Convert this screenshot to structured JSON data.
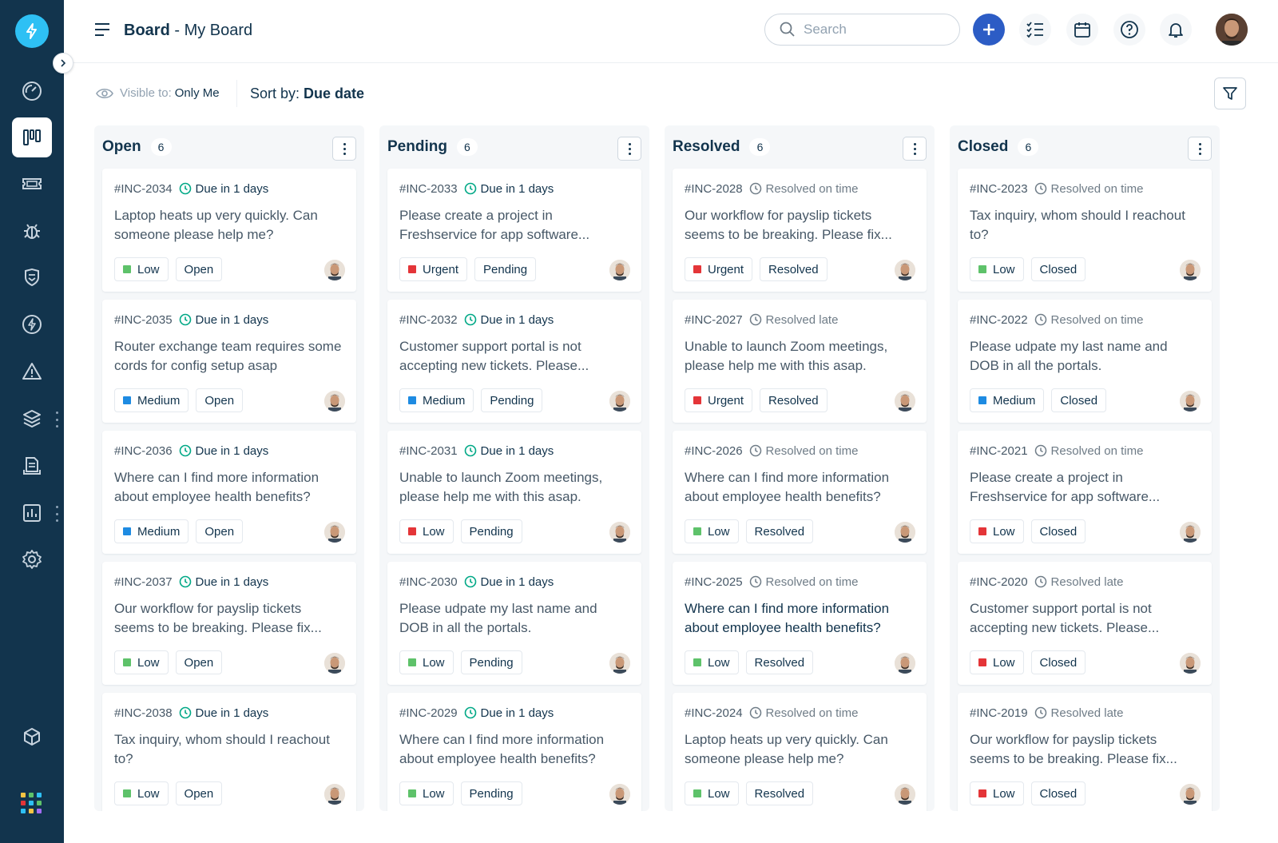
{
  "app": {
    "title_bold": "Board",
    "title_separator": "-",
    "title_name": "My Board"
  },
  "colors": {
    "sidebar": "#12344d",
    "accent": "#2c5cc5",
    "logo": "#2ec0f4",
    "priority_low_green": "#5ec26a",
    "priority_medium": "#1e8be2",
    "priority_urgent": "#e43538",
    "due_green": "#00a886"
  },
  "sidebar": {
    "items": [
      {
        "icon": "dashboard-icon"
      },
      {
        "icon": "board-icon",
        "active": true
      },
      {
        "icon": "ticket-icon"
      },
      {
        "icon": "bug-icon"
      },
      {
        "icon": "shield-icon"
      },
      {
        "icon": "lightning-icon"
      },
      {
        "icon": "alert-icon"
      },
      {
        "icon": "layers-icon"
      },
      {
        "icon": "document-icon"
      },
      {
        "icon": "reports-icon"
      },
      {
        "icon": "gear-icon"
      },
      {
        "icon": "cube-icon"
      },
      {
        "icon": "apps-grid-icon"
      }
    ]
  },
  "header": {
    "search_placeholder": "Search",
    "buttons": [
      "add-icon",
      "checklist-icon",
      "calendar-icon",
      "help-icon",
      "bell-icon"
    ]
  },
  "toolbar": {
    "visible_label": "Visible to:",
    "visible_value": "Only Me",
    "sort_label": "Sort by:",
    "sort_value": "Due date"
  },
  "columns": [
    {
      "title": "Open",
      "count": "6",
      "cards": [
        {
          "id": "#INC-2034",
          "due": "Due in 1 days",
          "due_kind": "green",
          "subject": "Laptop heats up very quickly. Can someone please help me?",
          "priority": "Low",
          "priority_color": "#5ec26a",
          "status": "Open"
        },
        {
          "id": "#INC-2035",
          "due": "Due in 1 days",
          "due_kind": "green",
          "subject": "Router exchange team requires some cords for config setup asap",
          "priority": "Medium",
          "priority_color": "#1e8be2",
          "status": "Open"
        },
        {
          "id": "#INC-2036",
          "due": "Due in 1 days",
          "due_kind": "green",
          "subject": "Where can I find more information about employee health benefits?",
          "priority": "Medium",
          "priority_color": "#1e8be2",
          "status": "Open"
        },
        {
          "id": "#INC-2037",
          "due": "Due in 1 days",
          "due_kind": "green",
          "subject": "Our workflow for payslip tickets seems to be breaking. Please fix...",
          "priority": "Low",
          "priority_color": "#5ec26a",
          "status": "Open"
        },
        {
          "id": "#INC-2038",
          "due": "Due in 1 days",
          "due_kind": "green",
          "subject": "Tax inquiry, whom should I reachout to?",
          "priority": "Low",
          "priority_color": "#5ec26a",
          "status": "Open"
        }
      ]
    },
    {
      "title": "Pending",
      "count": "6",
      "cards": [
        {
          "id": "#INC-2033",
          "due": "Due in 1 days",
          "due_kind": "green",
          "subject": "Please create a project in Freshservice for app software...",
          "priority": "Urgent",
          "priority_color": "#e43538",
          "status": "Pending"
        },
        {
          "id": "#INC-2032",
          "due": "Due in 1 days",
          "due_kind": "green",
          "subject": "Customer support portal is not accepting new tickets. Please...",
          "priority": "Medium",
          "priority_color": "#1e8be2",
          "status": "Pending"
        },
        {
          "id": "#INC-2031",
          "due": "Due in 1 days",
          "due_kind": "green",
          "subject": "Unable to launch Zoom meetings, please help me with this asap.",
          "priority": "Low",
          "priority_color": "#e43538",
          "status": "Pending"
        },
        {
          "id": "#INC-2030",
          "due": "Due in 1 days",
          "due_kind": "green",
          "subject": "Please udpate my last name and DOB in all the portals.",
          "priority": "Low",
          "priority_color": "#5ec26a",
          "status": "Pending"
        },
        {
          "id": "#INC-2029",
          "due": "Due in 1 days",
          "due_kind": "green",
          "subject": "Where can I find more information about employee health benefits?",
          "priority": "Low",
          "priority_color": "#5ec26a",
          "status": "Pending"
        }
      ]
    },
    {
      "title": "Resolved",
      "count": "6",
      "cards": [
        {
          "id": "#INC-2028",
          "due": "Resolved on time",
          "due_kind": "grey",
          "subject": "Our workflow for payslip tickets seems to be breaking. Please fix...",
          "priority": "Urgent",
          "priority_color": "#e43538",
          "status": "Resolved"
        },
        {
          "id": "#INC-2027",
          "due": "Resolved late",
          "due_kind": "grey",
          "subject": "Unable to launch Zoom meetings, please help me with this asap.",
          "priority": "Urgent",
          "priority_color": "#e43538",
          "status": "Resolved"
        },
        {
          "id": "#INC-2026",
          "due": "Resolved on time",
          "due_kind": "grey",
          "subject": "Where can I find more information about employee health benefits?",
          "priority": "Low",
          "priority_color": "#5ec26a",
          "status": "Resolved"
        },
        {
          "id": "#INC-2025",
          "due": "Resolved on time",
          "due_kind": "grey",
          "subject": "Where can I find more information about employee health benefits?",
          "priority": "Low",
          "priority_color": "#5ec26a",
          "status": "Resolved",
          "dark": true
        },
        {
          "id": "#INC-2024",
          "due": "Resolved on time",
          "due_kind": "grey",
          "subject": "Laptop heats up very quickly. Can someone please help me?",
          "priority": "Low",
          "priority_color": "#5ec26a",
          "status": "Resolved"
        }
      ]
    },
    {
      "title": "Closed",
      "count": "6",
      "cards": [
        {
          "id": "#INC-2023",
          "due": "Resolved on time",
          "due_kind": "grey",
          "subject": "Tax inquiry, whom should I reachout to?",
          "priority": "Low",
          "priority_color": "#5ec26a",
          "status": "Closed"
        },
        {
          "id": "#INC-2022",
          "due": "Resolved on time",
          "due_kind": "grey",
          "subject": "Please udpate my last name and DOB in all the portals.",
          "priority": "Medium",
          "priority_color": "#1e8be2",
          "status": "Closed"
        },
        {
          "id": "#INC-2021",
          "due": "Resolved on time",
          "due_kind": "grey",
          "subject": "Please create a project in Freshservice for app software...",
          "priority": "Low",
          "priority_color": "#e43538",
          "status": "Closed"
        },
        {
          "id": "#INC-2020",
          "due": "Resolved late",
          "due_kind": "grey",
          "subject": "Customer support portal is not accepting new tickets. Please...",
          "priority": "Low",
          "priority_color": "#e43538",
          "status": "Closed"
        },
        {
          "id": "#INC-2019",
          "due": "Resolved late",
          "due_kind": "grey",
          "subject": "Our workflow for payslip tickets seems to be breaking. Please fix...",
          "priority": "Low",
          "priority_color": "#e43538",
          "status": "Closed"
        }
      ]
    }
  ]
}
